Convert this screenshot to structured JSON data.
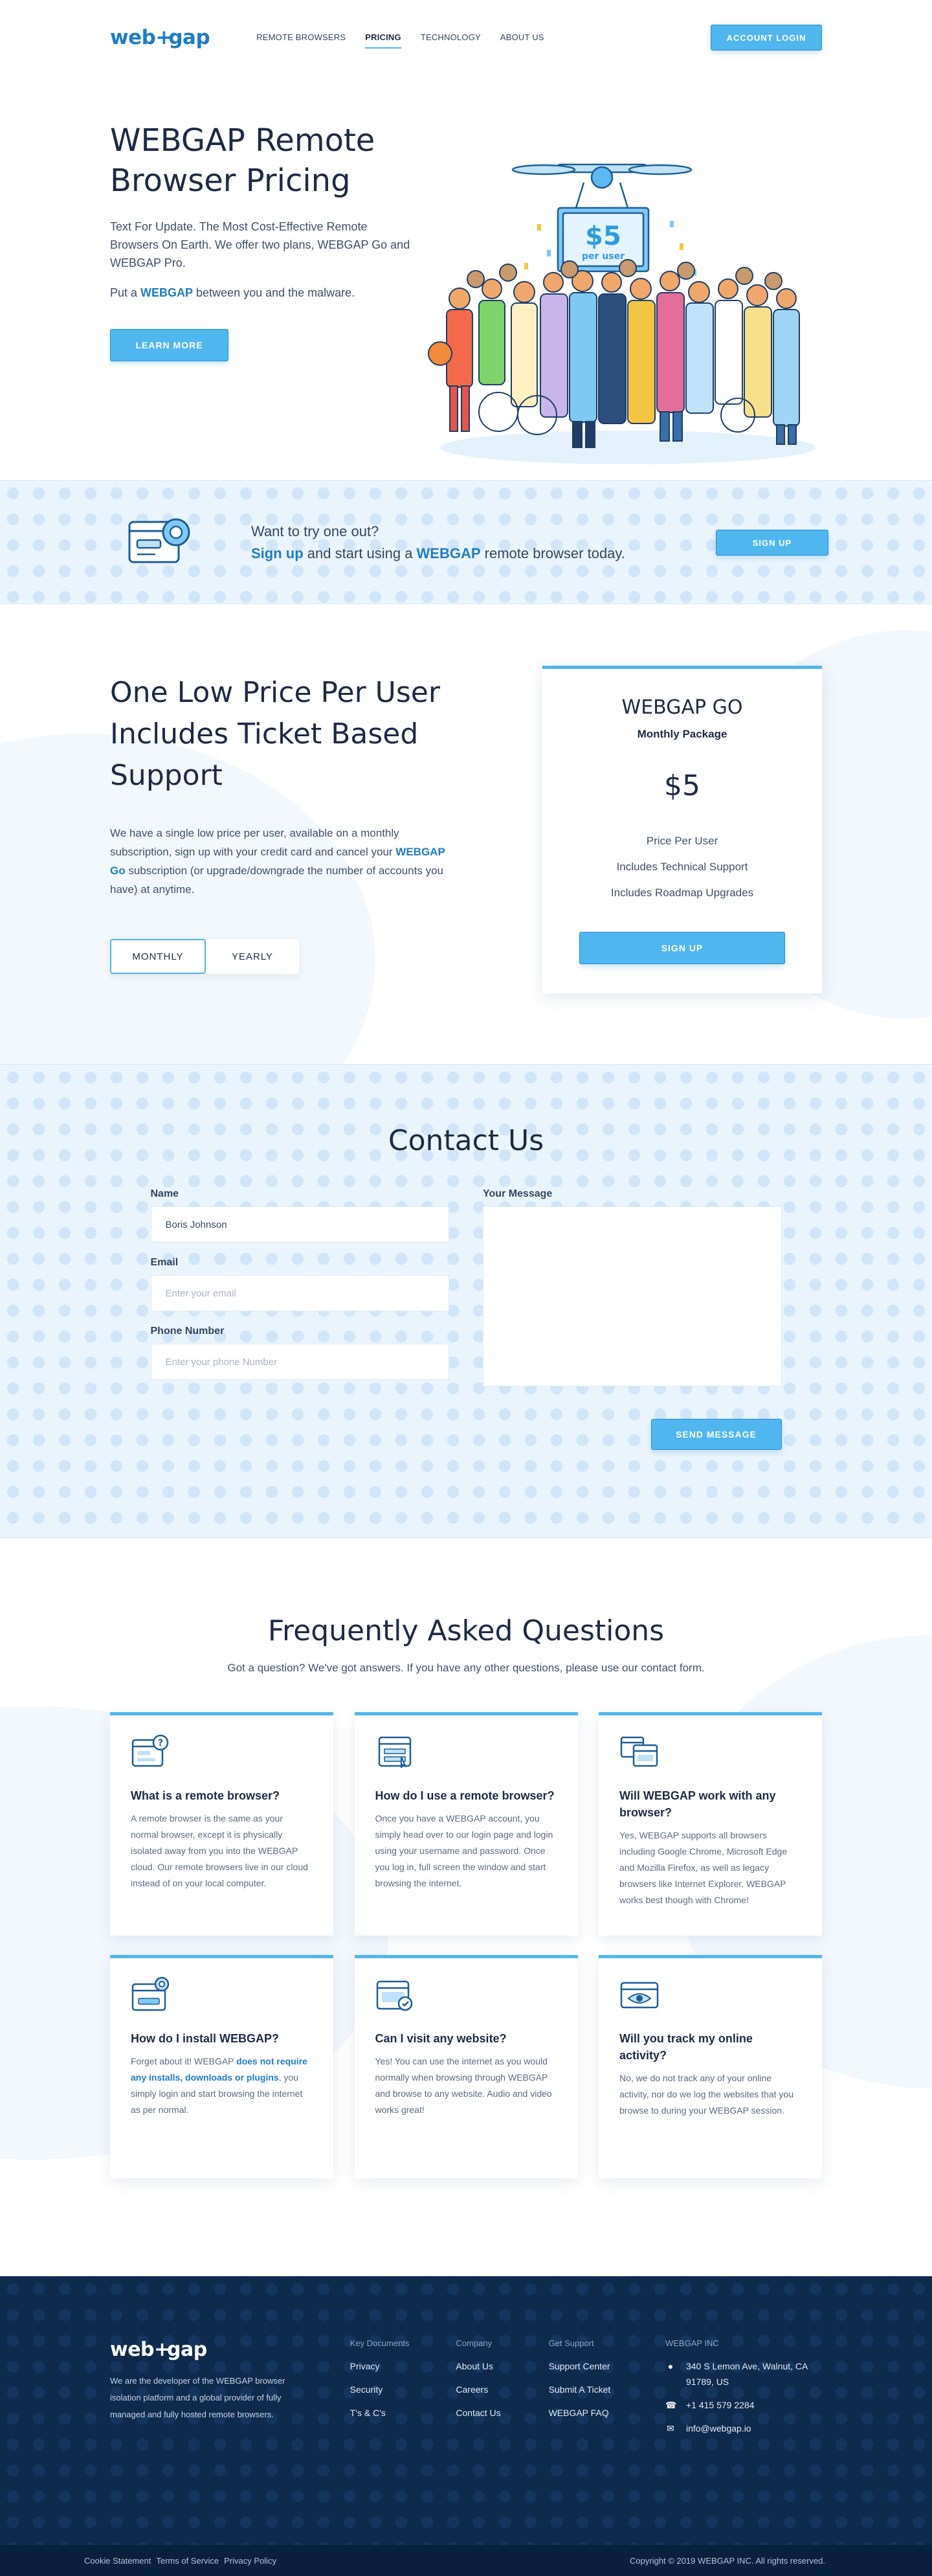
{
  "brand": {
    "logo_left": "web",
    "logo_plus": "+",
    "logo_right": "gap"
  },
  "nav": {
    "items": [
      "REMOTE BROWSERS",
      "PRICING",
      "TECHNOLOGY",
      "ABOUT US"
    ],
    "active": "PRICING",
    "login_label": "ACCOUNT LOGIN"
  },
  "hero": {
    "title": "WEBGAP Remote Browser Pricing",
    "para1": "Text For Update. The Most Cost-Effective Remote Browsers On Earth. We offer two plans, WEBGAP Go and WEBGAP Pro.",
    "para2_before": "Put a ",
    "para2_link": "WEBGAP",
    "para2_after": " between you and the malware.",
    "cta_label": "LEARN MORE",
    "sign_price": "$5",
    "sign_unit": "per user"
  },
  "try": {
    "line1": "Want to try one out?",
    "line2_link1": "Sign up",
    "line2_mid": " and start using a ",
    "line2_link2": "WEBGAP",
    "line2_end": " remote browser today.",
    "button_label": "SIGN UP"
  },
  "pricing": {
    "title": "One Low Price Per User Includes Ticket Based Support",
    "desc_before": "We have a single low price per user, available on a monthly subscription, sign up with your credit card and cancel your ",
    "desc_link": "WEBGAP Go",
    "desc_after": " subscription (or upgrade/downgrade the number of accounts you have) at anytime.",
    "toggle_monthly": "MONTHLY",
    "toggle_yearly": "YEARLY",
    "card": {
      "name": "WEBGAP GO",
      "package": "Monthly Package",
      "price": "$5",
      "features": [
        "Price Per User",
        "Includes Technical Support",
        "Includes Roadmap Upgrades"
      ],
      "button_label": "SIGN UP"
    }
  },
  "contact": {
    "title": "Contact Us",
    "name_label": "Name",
    "name_value": "Boris Johnson",
    "email_label": "Email",
    "email_placeholder": "Enter your email",
    "phone_label": "Phone Number",
    "phone_placeholder": "Enter your phone Number",
    "message_label": "Your Message",
    "button_label": "SEND MESSAGE"
  },
  "faq": {
    "title": "Frequently Asked Questions",
    "subtitle": "Got a question? We've got answers. If you have any other questions, please use our contact form.",
    "items": [
      {
        "q": "What is a remote browser?",
        "a": "A remote browser is the same as your normal browser, except it is physically isolated away from you into the WEBGAP cloud. Our remote browsers live in our cloud instead of on your local computer.",
        "icon": "question-window-icon"
      },
      {
        "q": "How do I use a remote browser?",
        "a": "Once you have a WEBGAP account, you simply head over to our login page and login using your username and password. Once you log in, full screen the window and start browsing the internet.",
        "icon": "login-window-icon"
      },
      {
        "q": "Will WEBGAP work with any browser?",
        "a": "Yes, WEBGAP supports all browsers including Google Chrome, Microsoft Edge and Mozilla Firefox, as well as legacy browsers like Internet Explorer. WEBGAP works best though with Chrome!",
        "icon": "browser-windows-icon"
      },
      {
        "q": "How do I install WEBGAP?",
        "a_before": "Forget about it! WEBGAP ",
        "a_link": "does not require any installs, downloads or plugins",
        "a_after": ", you simply login and start browsing the internet as per normal.",
        "icon": "install-window-icon"
      },
      {
        "q": "Can I visit any website?",
        "a": "Yes! You can use the internet as you would normally when browsing through WEBGAP and browse to any website. Audio and video works great!",
        "icon": "website-window-icon"
      },
      {
        "q": "Will you track my online activity?",
        "a": "No, we do not track any of your online activity, nor do we log the websites that you browse to during your WEBGAP session.",
        "icon": "eye-window-icon"
      }
    ]
  },
  "footer": {
    "about": "We are the developer of the WEBGAP browser isolation platform and a global provider of fully managed and fully hosted remote browsers.",
    "col1": {
      "heading": "Key Documents",
      "links": [
        "Privacy",
        "Security",
        "T's & C's"
      ]
    },
    "col2": {
      "heading": "Company",
      "links": [
        "About Us",
        "Careers",
        "Contact Us"
      ]
    },
    "col3": {
      "heading": "Get Support",
      "links": [
        "Support Center",
        "Submit A Ticket",
        "WEBGAP FAQ"
      ]
    },
    "inc": {
      "heading": "WEBGAP INC",
      "address": "340 S Lemon Ave, Walnut, CA 91789, US",
      "phone": "+1 415 579 2284",
      "email": "info@webgap.io"
    },
    "bottom_links": [
      "Cookie Statement",
      "Terms of Service",
      "Privacy Policy"
    ],
    "copyright": "Copyright © 2019 WEBGAP INC. All rights reserved."
  },
  "colors": {
    "accent": "#4fb6ee",
    "brand": "#1d7cc4",
    "heading": "#1d2a44",
    "footer_bg": "#0e2a4d"
  }
}
